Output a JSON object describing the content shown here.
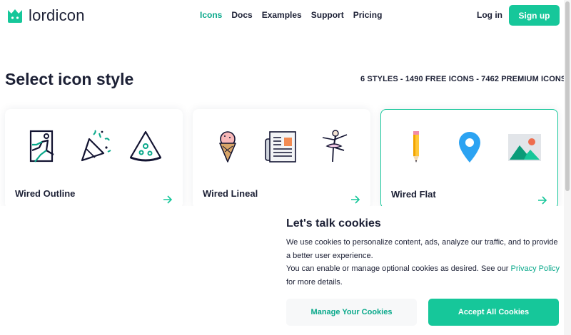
{
  "brand": {
    "name": "lordicon",
    "accent": "#16c79a",
    "accent_dark": "#08a88a",
    "logo_icon": "crown-icon"
  },
  "nav": {
    "items": [
      {
        "label": "Icons",
        "active": true
      },
      {
        "label": "Docs",
        "active": false
      },
      {
        "label": "Examples",
        "active": false
      },
      {
        "label": "Support",
        "active": false
      },
      {
        "label": "Pricing",
        "active": false
      }
    ],
    "login": "Log in",
    "signup": "Sign up"
  },
  "main": {
    "title": "Select icon style",
    "stats": "6 STYLES - 1490 FREE ICONS - 7462 PREMIUM ICONS"
  },
  "cards": [
    {
      "name": "Wired Outline",
      "selected": false,
      "icons": [
        "runner-exit-icon",
        "party-popper-icon",
        "pizza-slice-icon"
      ]
    },
    {
      "name": "Wired Lineal",
      "selected": false,
      "icons": [
        "ice-cream-icon",
        "newspaper-icon",
        "ballerina-icon"
      ]
    },
    {
      "name": "Wired Flat",
      "selected": true,
      "icons": [
        "pencil-icon",
        "location-pin-icon",
        "image-landscape-icon"
      ]
    }
  ],
  "cookie": {
    "title": "Let's talk cookies",
    "text1": "We use cookies to personalize content, ads, analyze our traffic, and to provide a better user experience.",
    "text2": "You can enable or manage optional cookies as desired. See our",
    "link": "Privacy Policy",
    "text3": "for more details.",
    "manage": "Manage Your Cookies",
    "accept": "Accept All Cookies"
  }
}
